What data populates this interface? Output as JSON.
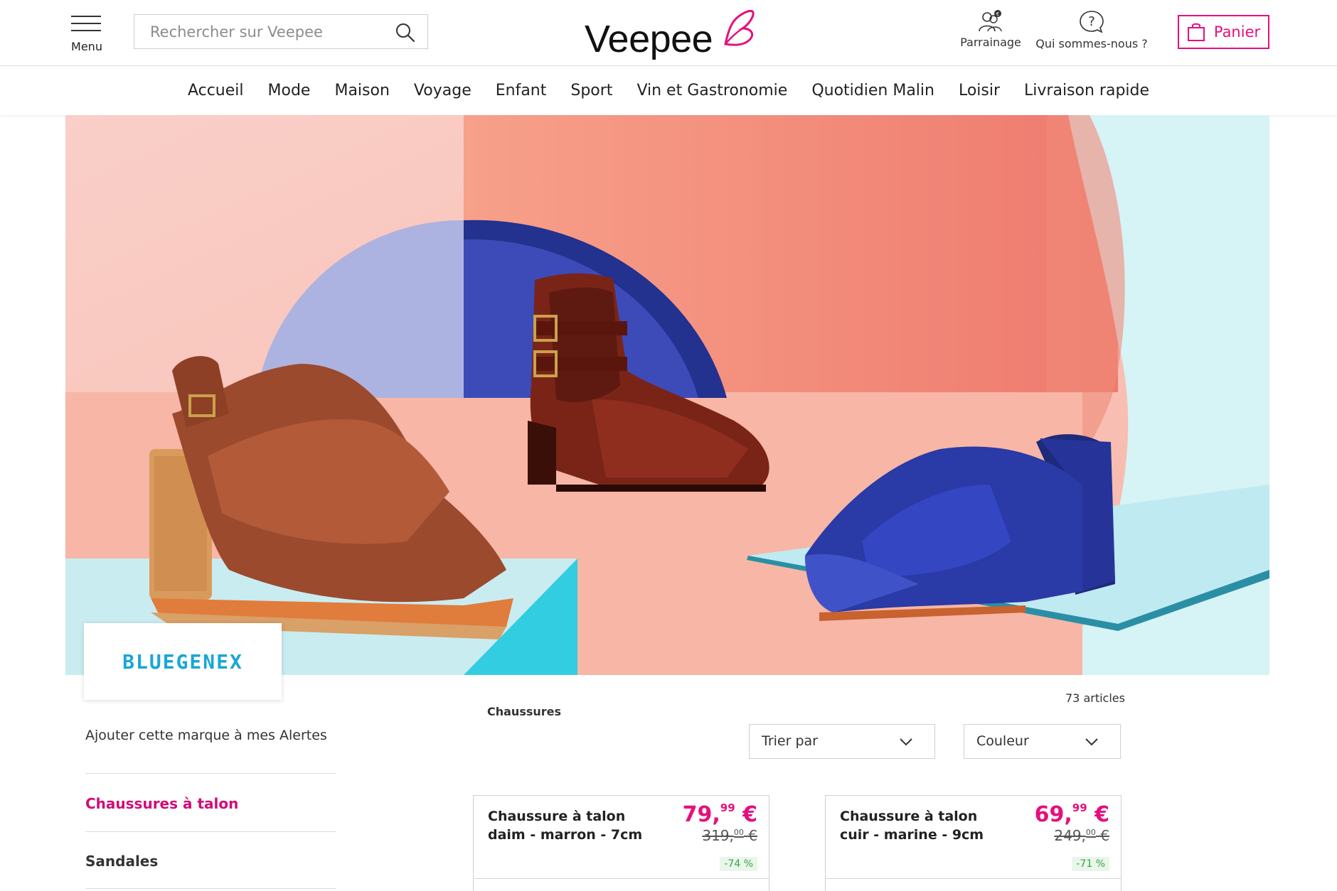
{
  "header": {
    "menu_label": "Menu",
    "search_placeholder": "Rechercher sur Veepee",
    "logo_text": "Veepee",
    "parrainage_label": "Parrainage",
    "qui_label": "Qui sommes-nous ?",
    "cart_label": "Panier",
    "accent_color": "#e5107d"
  },
  "nav": {
    "items": [
      "Accueil",
      "Mode",
      "Maison",
      "Voyage",
      "Enfant",
      "Sport",
      "Vin et Gastronomie",
      "Quotidien Malin",
      "Loisir",
      "Livraison rapide"
    ]
  },
  "brand": {
    "name": "BLUEGENEX"
  },
  "sidebar": {
    "alert_label": "Ajouter cette marque à mes Alertes",
    "categories": [
      {
        "label": "Chaussures à talon",
        "active": true
      },
      {
        "label": "Sandales",
        "active": false
      }
    ]
  },
  "listing": {
    "section_title": "Chaussures",
    "count_label": "73 articles",
    "sort_label": "Trier par",
    "color_label": "Couleur"
  },
  "products": [
    {
      "name": "Chaussure à talon\ndaim - marron - 7cm",
      "price_int": "79,",
      "price_dec": "99",
      "currency": " €",
      "old_int": "319,",
      "old_dec": "00",
      "old_currency": " €",
      "discount": "-74 %"
    },
    {
      "name": "Chaussure à talon\ncuir - marine - 9cm",
      "price_int": "69,",
      "price_dec": "99",
      "currency": " €",
      "old_int": "249,",
      "old_dec": "00",
      "old_currency": " €",
      "discount": "-71 %"
    }
  ]
}
